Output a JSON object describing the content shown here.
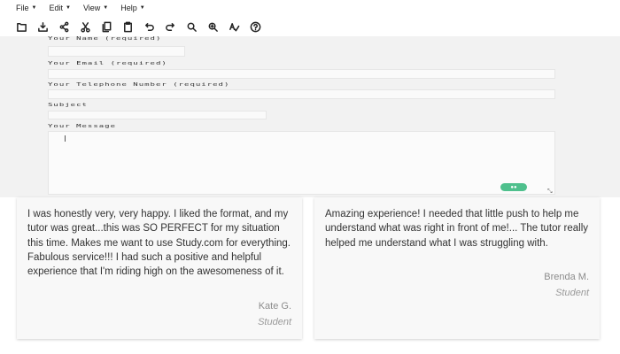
{
  "menubar": {
    "items": [
      {
        "label": "File"
      },
      {
        "label": "Edit"
      },
      {
        "label": "View"
      },
      {
        "label": "Help"
      }
    ]
  },
  "toolbar": {
    "icons": [
      "new-document-icon",
      "download-icon",
      "share-icon",
      "cut-icon",
      "copy-icon",
      "paste-icon",
      "undo-icon",
      "redo-icon",
      "zoom-in-icon",
      "zoom-out-icon",
      "spellcheck-icon",
      "help-icon"
    ]
  },
  "form": {
    "name_label": "Your Name (required)",
    "email_label": "Your Email (required)",
    "phone_label": "Your Telephone Number (required)",
    "subject_label": "Subject",
    "message_label": "Your Message"
  },
  "testimonials": [
    {
      "quote": "I was honestly very, very happy. I liked the format, and my tutor was great...this was SO PERFECT for my situation this time. Makes me want to use Study.com for everything. Fabulous service!!! I had such a positive and helpful experience that I'm riding high on the awesomeness of it.",
      "author": "Kate G.",
      "role": "Student"
    },
    {
      "quote": "Amazing experience! I needed that little push to help me understand what was right in front of me!... The tutor really helped me understand what I was struggling with.",
      "author": "Brenda M.",
      "role": "Student"
    }
  ],
  "colors": {
    "form_background": "#f2f2f2",
    "badge_green": "#4fc08d",
    "card_background": "#f8f8f8"
  }
}
